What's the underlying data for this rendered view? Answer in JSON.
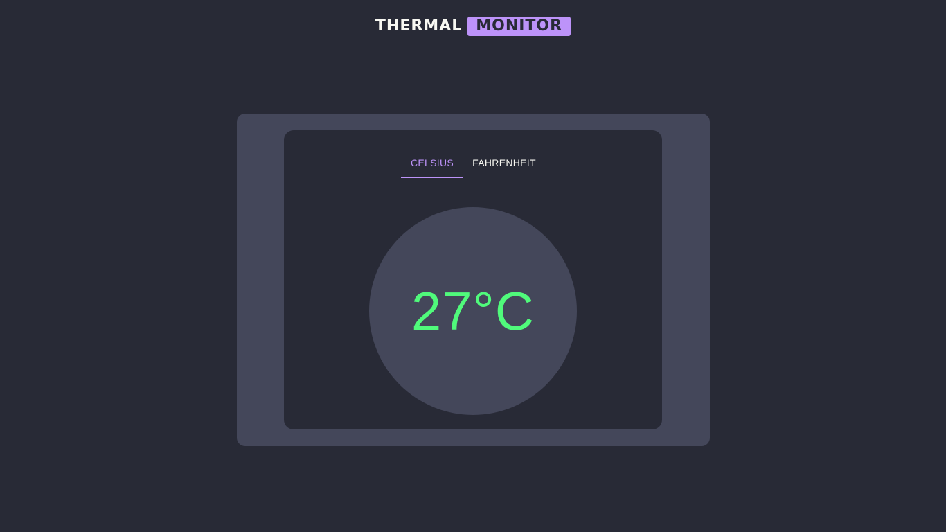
{
  "header": {
    "brand_part1": "THERMAL",
    "brand_part2": "MONITOR"
  },
  "tabs": [
    {
      "label": "CELSIUS",
      "active": true
    },
    {
      "label": "FAHRENHEIT",
      "active": false
    }
  ],
  "reading": {
    "display": "27°C"
  },
  "colors": {
    "background": "#282a36",
    "card": "#44475a",
    "accent": "#bd93f9",
    "reading": "#50fa7b",
    "text": "#f8f8f2"
  }
}
